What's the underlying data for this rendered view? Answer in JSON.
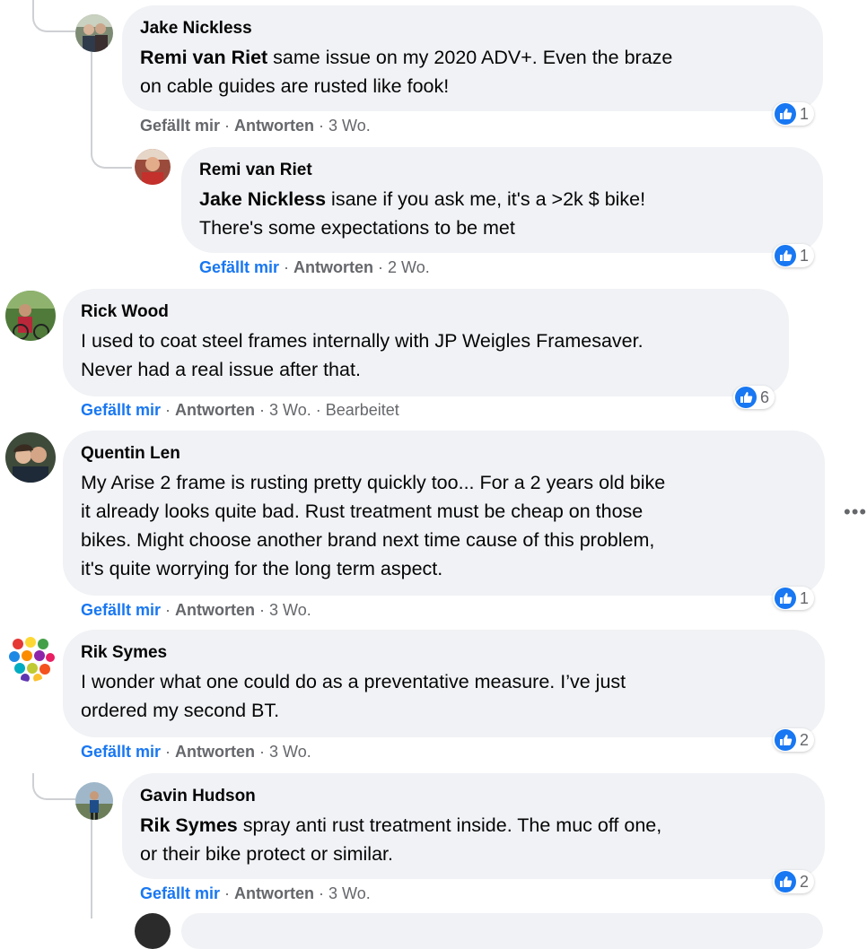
{
  "comments": [
    {
      "author": "Jake Nickless",
      "mention": "Remi van Riet",
      "body": "same issue on my 2020 ADV+. Even the braze",
      "body2": "on cable guides are rusted like fook!",
      "like_label": "Gefällt mir",
      "reply_label": "Antworten",
      "time": "3 Wo.",
      "reactions": "1"
    },
    {
      "author": "Remi van Riet",
      "mention": "Jake Nickless",
      "body": "isane if you ask me, it's a >2k $ bike!",
      "body2": "There's some expectations to be met",
      "like_label": "Gefällt mir",
      "reply_label": "Antworten",
      "time": "2 Wo.",
      "reactions": "1"
    },
    {
      "author": "Rick Wood",
      "body": "I used to coat steel frames internally with JP Weigles Framesaver.",
      "body2": "Never had a real issue after that.",
      "like_label": "Gefällt mir",
      "reply_label": "Antworten",
      "time": "3 Wo.",
      "edited": "Bearbeitet",
      "reactions": "6"
    },
    {
      "author": "Quentin Len",
      "body": "My Arise 2 frame is rusting pretty quickly too... For a 2 years old bike",
      "body2": "it already looks quite bad. Rust treatment must be cheap on those",
      "body3": "bikes. Might choose another brand next time cause of this problem,",
      "body4": "it's quite worrying for the long term aspect.",
      "like_label": "Gefällt mir",
      "reply_label": "Antworten",
      "time": "3 Wo.",
      "reactions": "1"
    },
    {
      "author": "Rik Symes",
      "body": "I wonder what one could do as a preventative measure. I’ve just",
      "body2": "ordered my second BT.",
      "like_label": "Gefällt mir",
      "reply_label": "Antworten",
      "time": "3 Wo.",
      "reactions": "2"
    },
    {
      "author": "Gavin Hudson",
      "mention": "Rik Symes",
      "body": "spray anti rust treatment inside. The muc off one,",
      "body2": "or their bike protect or similar.",
      "like_label": "Gefällt mir",
      "reply_label": "Antworten",
      "time": "3 Wo.",
      "reactions": "2"
    }
  ],
  "separator": "·",
  "more_label": "•••",
  "colors": {
    "bubble": "#f0f2f5",
    "link_blue": "#1877f2",
    "secondary_text": "#65676b",
    "thread_line": "#ced0d4"
  },
  "icons": {
    "reaction": "like-thumbs-up-icon",
    "menu": "more-options-icon"
  }
}
